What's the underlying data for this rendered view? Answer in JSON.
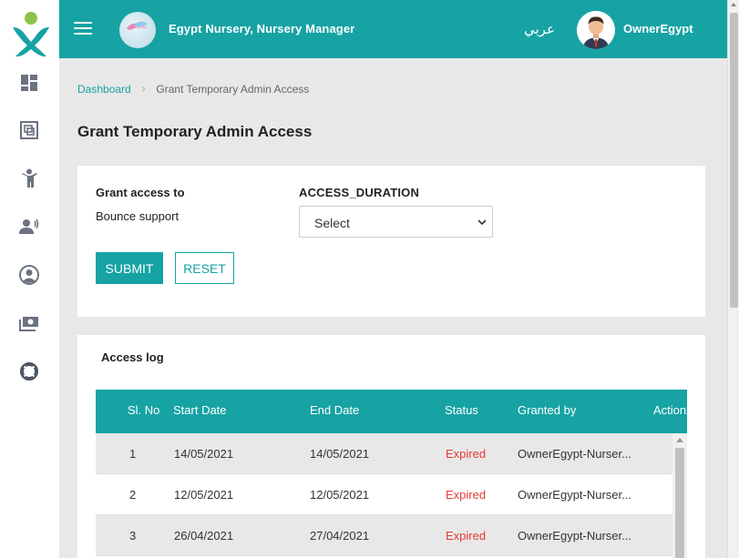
{
  "header": {
    "title": "Egypt Nursery, Nursery Manager",
    "language": "عربي",
    "username": "OwnerEgypt"
  },
  "sidebar": {
    "items": [
      {
        "icon": "dashboard-icon"
      },
      {
        "icon": "gallery-icon"
      },
      {
        "icon": "child-icon"
      },
      {
        "icon": "parents-icon"
      },
      {
        "icon": "user-icon"
      },
      {
        "icon": "payments-icon"
      },
      {
        "icon": "support-icon"
      }
    ]
  },
  "breadcrumb": {
    "home": "Dashboard",
    "current": "Grant Temporary Admin Access"
  },
  "page_title": "Grant Temporary Admin Access",
  "form": {
    "grant_label": "Grant access to",
    "grant_value": "Bounce support",
    "duration_label": "ACCESS_DURATION",
    "duration_selected": "Select",
    "submit_label": "SUBMIT",
    "reset_label": "RESET"
  },
  "access_log": {
    "title": "Access log",
    "columns": [
      "Sl. No",
      "Start Date",
      "End Date",
      "Status",
      "Granted by",
      "Actions"
    ],
    "rows": [
      {
        "no": "1",
        "start": "14/05/2021",
        "end": "14/05/2021",
        "status": "Expired",
        "granted_by": "OwnerEgypt-Nurser..."
      },
      {
        "no": "2",
        "start": "12/05/2021",
        "end": "12/05/2021",
        "status": "Expired",
        "granted_by": "OwnerEgypt-Nurser..."
      },
      {
        "no": "3",
        "start": "26/04/2021",
        "end": "27/04/2021",
        "status": "Expired",
        "granted_by": "OwnerEgypt-Nurser..."
      }
    ]
  },
  "colors": {
    "primary": "#17a2a4",
    "expired": "#e53935",
    "logo_green": "#8bc34a",
    "logo_teal": "#17a2a4"
  }
}
